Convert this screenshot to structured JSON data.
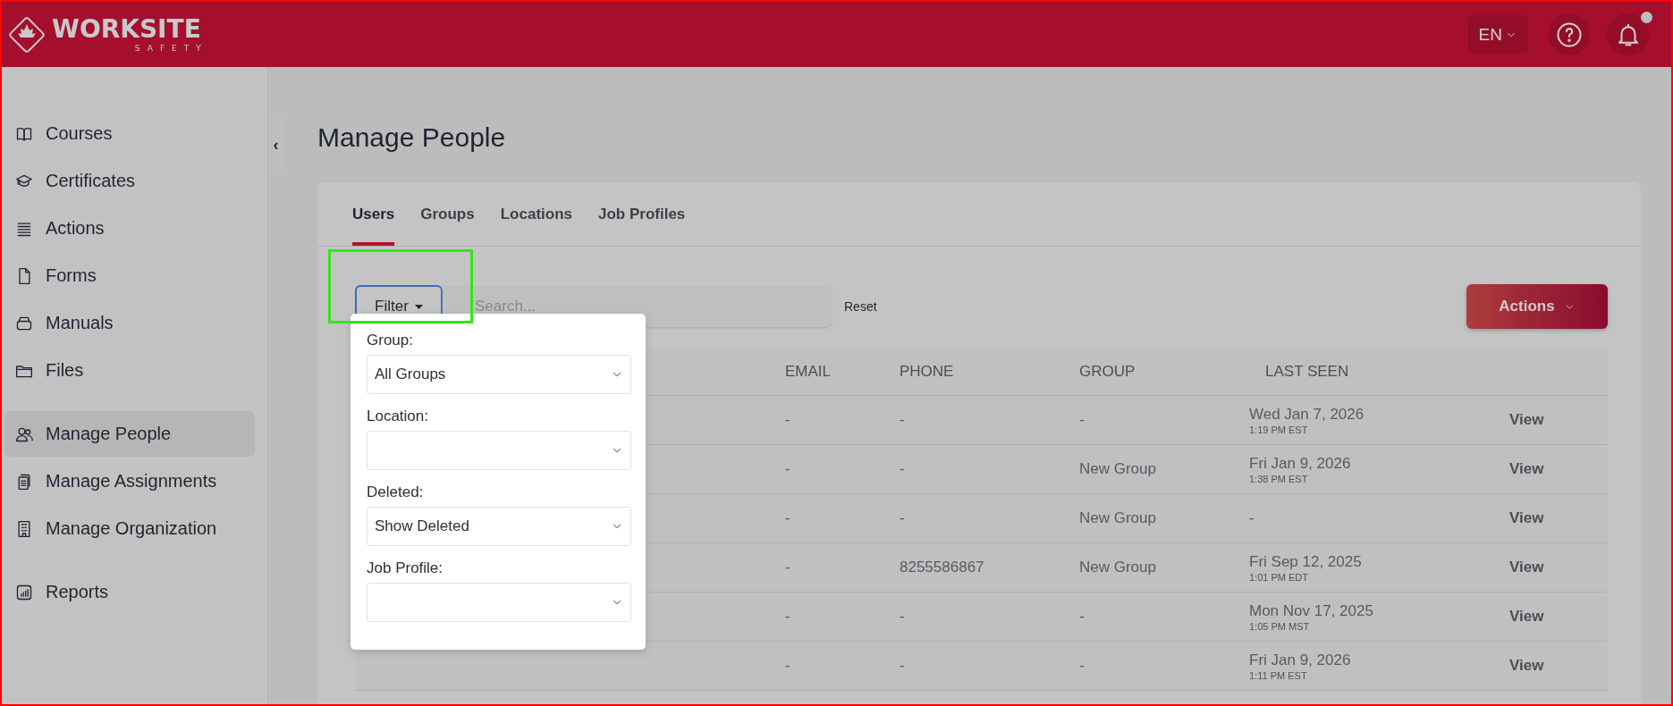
{
  "header": {
    "logo": {
      "name": "WORKSITE",
      "tagline": "SAFETY"
    },
    "language": "EN",
    "notifications": {
      "unread": true
    }
  },
  "sidebar": {
    "collapse": "‹",
    "sections": [
      [
        {
          "label": "Courses",
          "kind": "book",
          "selected": false
        },
        {
          "label": "Certificates",
          "kind": "cap",
          "selected": false
        },
        {
          "label": "Actions",
          "kind": "lines",
          "selected": false
        },
        {
          "label": "Forms",
          "kind": "file",
          "selected": false
        },
        {
          "label": "Manuals",
          "kind": "box",
          "selected": false
        },
        {
          "label": "Files",
          "kind": "folder",
          "selected": false
        }
      ],
      [
        {
          "label": "Manage People",
          "kind": "people",
          "selected": true
        },
        {
          "label": "Manage Assignments",
          "kind": "clipboard",
          "selected": false
        },
        {
          "label": "Manage Organization",
          "kind": "building",
          "selected": false
        }
      ],
      [
        {
          "label": "Reports",
          "kind": "chart",
          "selected": false
        }
      ]
    ]
  },
  "page": {
    "title": "Manage People",
    "tabs": [
      {
        "label": "Users",
        "selected": true
      },
      {
        "label": "Groups",
        "selected": false
      },
      {
        "label": "Locations",
        "selected": false
      },
      {
        "label": "Job Profiles",
        "selected": false
      }
    ],
    "toolbar": {
      "filter": "Filter",
      "search": {
        "placeholder": "Search..."
      },
      "reset": "Reset",
      "actions": "Actions"
    },
    "table": {
      "columns": [
        "EMAIL",
        "PHONE",
        "GROUP",
        "LAST SEEN"
      ],
      "rows": [
        {
          "email": "-",
          "phone": "-",
          "group": "-",
          "date": "Wed Jan 7, 2026",
          "time": "1:19 PM EST",
          "action": "View"
        },
        {
          "email": "-",
          "phone": "-",
          "group": "New Group",
          "date": "Fri Jan 9, 2026",
          "time": "1:38 PM EST",
          "action": "View"
        },
        {
          "email": "-",
          "phone": "-",
          "group": "New Group",
          "date": "-",
          "action": "View"
        },
        {
          "email": "-",
          "phone": "8255586867",
          "group": "New Group",
          "date": "Fri Sep 12, 2025",
          "time": "1:01 PM EDT",
          "action": "View"
        },
        {
          "email": "-",
          "phone": "-",
          "group": "-",
          "date": "Mon Nov 17, 2025",
          "time": "1:05 PM MST",
          "action": "View"
        },
        {
          "email": "-",
          "phone": "-",
          "group": "-",
          "date": "Fri Jan 9, 2026",
          "time": "1:11 PM EST",
          "action": "View"
        }
      ]
    },
    "filter_menu": {
      "fields": [
        {
          "label": "Group:",
          "value": "All Groups"
        },
        {
          "label": "Location:"
        },
        {
          "label": "Deleted:",
          "value": "Show Deleted"
        },
        {
          "label": "Job Profile:"
        }
      ]
    }
  },
  "annotations": {
    "highlight": true
  }
}
